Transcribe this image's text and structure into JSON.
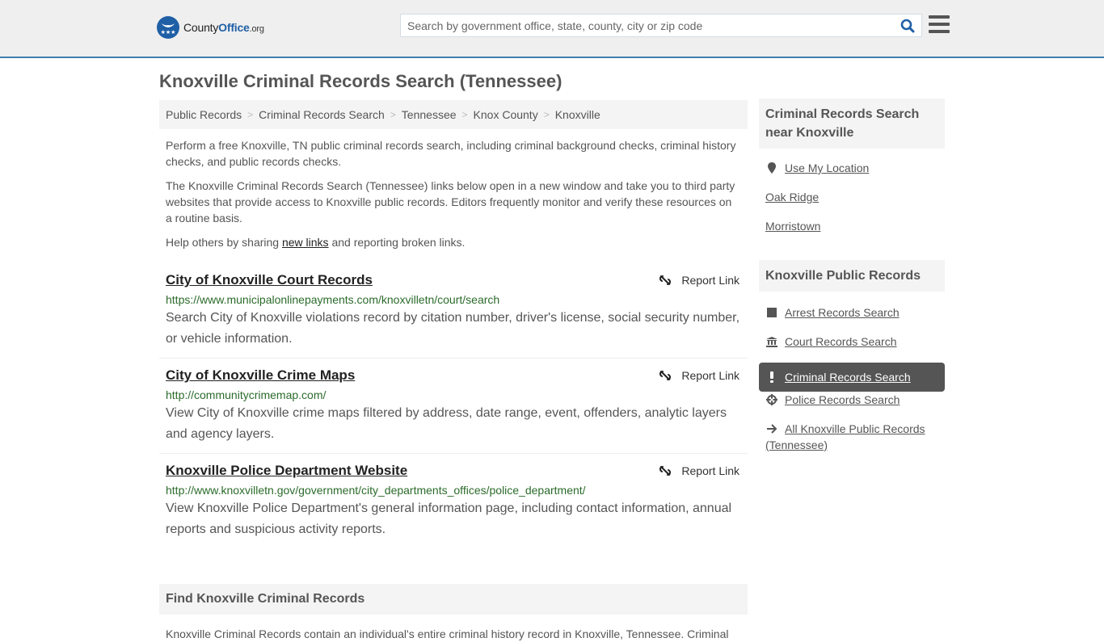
{
  "header": {
    "logo": {
      "name": "County",
      "accent": "Office",
      "tld": ".org"
    },
    "search": {
      "placeholder": "Search by government office, state, county, city or zip code",
      "value": ""
    },
    "colors": {
      "brand": "#1f5fa6",
      "header_border": "#3d7eac",
      "header_bg": "#efefef"
    }
  },
  "page": {
    "title": "Knoxville Criminal Records Search (Tennessee)"
  },
  "breadcrumb": [
    {
      "label": "Public Records"
    },
    {
      "label": "Criminal Records Search"
    },
    {
      "label": "Tennessee"
    },
    {
      "label": "Knox County"
    },
    {
      "label": "Knoxville"
    }
  ],
  "breadcrumb_separator": ">",
  "intro": {
    "p1": "Perform a free Knoxville, TN public criminal records search, including criminal background checks, criminal history checks, and public records checks.",
    "p2": "The Knoxville Criminal Records Search (Tennessee) links below open in a new window and take you to third party websites that provide access to Knoxville public records. Editors frequently monitor and verify these resources on a routine basis.",
    "p3_before": "Help others by sharing ",
    "p3_link": "new links",
    "p3_after": " and reporting broken links."
  },
  "results": [
    {
      "title": "City of Knoxville Court Records",
      "url": "https://www.municipalonlinepayments.com/knoxvilletn/court/search",
      "description": "Search City of Knoxville violations record by citation number, driver's license, social security number, or vehicle information.",
      "report_label": "Report Link"
    },
    {
      "title": "City of Knoxville Crime Maps",
      "url": "http://communitycrimemap.com/",
      "description": "View City of Knoxville crime maps filtered by address, date range, event, offenders, analytic layers and agency layers.",
      "report_label": "Report Link"
    },
    {
      "title": "Knoxville Police Department Website",
      "url": "http://www.knoxvilletn.gov/government/city_departments_offices/police_department/",
      "description": "View Knoxville Police Department's general information page, including contact information, annual reports and suspicious activity reports.",
      "report_label": "Report Link"
    }
  ],
  "find": {
    "heading": "Find Knoxville Criminal Records",
    "text": "Knoxville Criminal Records contain an individual's entire criminal history record in Knoxville, Tennessee. Criminal"
  },
  "sidebar": {
    "nearby": {
      "heading": "Criminal Records Search near Knoxville",
      "items": [
        {
          "label": "Use My Location",
          "icon": "map-marker-icon"
        },
        {
          "label": "Oak Ridge"
        },
        {
          "label": "Morristown"
        }
      ]
    },
    "public_records": {
      "heading": "Knoxville Public Records",
      "items": [
        {
          "label": "Arrest Records Search",
          "icon": "square-icon",
          "active": false
        },
        {
          "label": "Court Records Search",
          "icon": "courthouse-icon",
          "active": false
        },
        {
          "label": "Criminal Records Search",
          "icon": "exclamation-icon",
          "active": true
        },
        {
          "label": "Police Records Search",
          "icon": "crosshair-icon",
          "active": false
        },
        {
          "label": "All Knoxville Public Records (Tennessee)",
          "icon": "arrow-right-icon",
          "active": false
        }
      ]
    }
  }
}
